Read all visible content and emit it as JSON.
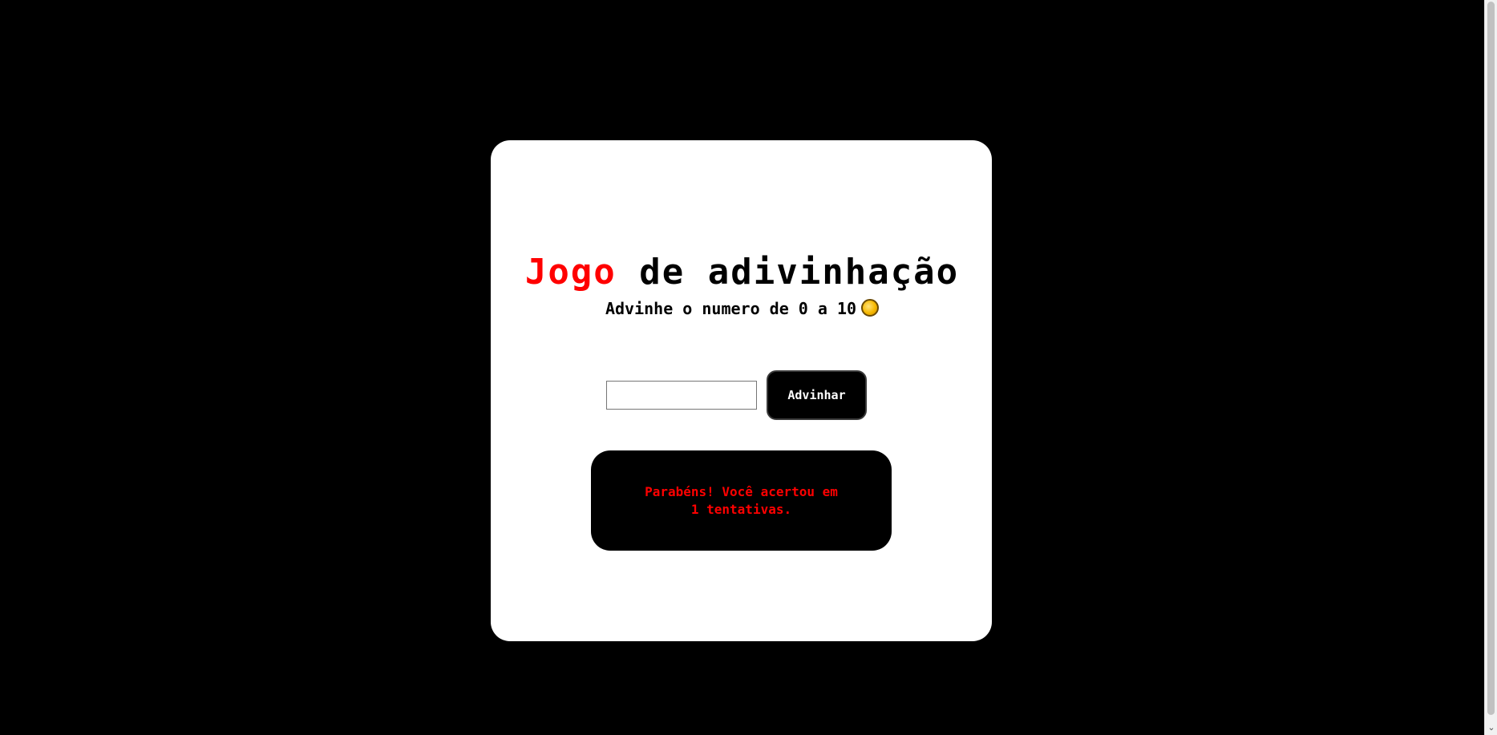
{
  "game": {
    "title_accent": "Jogo",
    "title_rest": "de adivinhação",
    "subtitle": "Advinhe o numero de 0 a 10",
    "subtitle_icon": "coin-icon",
    "input_value": "",
    "guess_button_label": "Advinhar",
    "result_message": "Parabéns! Você acertou em 1 tentativas."
  },
  "colors": {
    "background": "#000000",
    "card": "#ffffff",
    "accent": "#ff0000",
    "button": "#000000",
    "result_text": "#ff0000"
  }
}
